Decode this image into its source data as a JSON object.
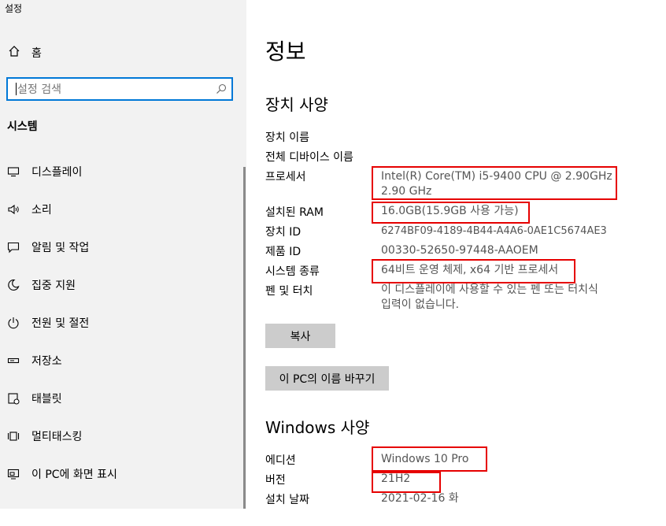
{
  "window": {
    "title": "설정"
  },
  "sidebar": {
    "home_label": "홈",
    "search_placeholder": "설정 검색",
    "section": "시스템",
    "items": [
      {
        "label": "디스플레이",
        "icon": "monitor-icon"
      },
      {
        "label": "소리",
        "icon": "speaker-icon"
      },
      {
        "label": "알림 및 작업",
        "icon": "notification-icon"
      },
      {
        "label": "집중 지원",
        "icon": "moon-icon"
      },
      {
        "label": "전원 및 절전",
        "icon": "power-icon"
      },
      {
        "label": "저장소",
        "icon": "storage-icon"
      },
      {
        "label": "태블릿",
        "icon": "tablet-icon"
      },
      {
        "label": "멀티태스킹",
        "icon": "multitasking-icon"
      },
      {
        "label": "이 PC에 화면 표시",
        "icon": "project-icon"
      }
    ]
  },
  "main": {
    "title": "정보",
    "device_specs": {
      "heading": "장치 사양",
      "rows": [
        {
          "key": "장치 이름",
          "value": ""
        },
        {
          "key": "전체 디바이스 이름",
          "value": ""
        },
        {
          "key": "프로세서",
          "value": "Intel(R) Core(TM) i5-9400 CPU @ 2.90GHz",
          "value2": "2.90 GHz"
        },
        {
          "key": "설치된 RAM",
          "value": "16.0GB(15.9GB 사용 가능)"
        },
        {
          "key": "장치 ID",
          "value": "6274BF09-4189-4B44-A4A6-0AE1C5674AE3"
        },
        {
          "key": "제품 ID",
          "value": "00330-52650-97448-AAOEM"
        },
        {
          "key": "시스템 종류",
          "value": "64비트 운영 체제, x64 기반 프로세서"
        },
        {
          "key": "펜 및 터치",
          "value": "이 디스플레이에 사용할 수 있는 펜 또는 터치식",
          "value2": "입력이 없습니다."
        }
      ],
      "copy_button": "복사",
      "rename_button": "이 PC의 이름 바꾸기"
    },
    "windows_specs": {
      "heading": "Windows 사양",
      "rows": [
        {
          "key": "에디션",
          "value": "Windows 10 Pro"
        },
        {
          "key": "버전",
          "value": "21H2"
        },
        {
          "key": "설치 날짜",
          "value": "2021-02-16 화"
        }
      ]
    }
  },
  "colors": {
    "accent": "#0078d7",
    "highlight": "#e60000",
    "sidebar_bg": "#f2f2f2",
    "button_bg": "#cccccc"
  }
}
